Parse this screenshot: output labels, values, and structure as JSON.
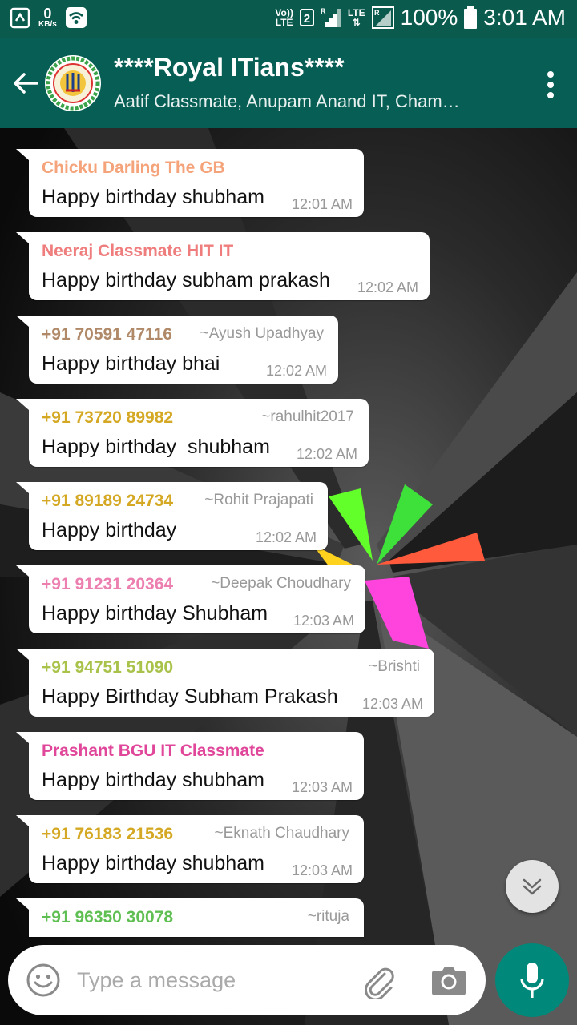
{
  "status_bar": {
    "speed_value": "0",
    "speed_unit": "KB/s",
    "volte": "Vo))\nLTE",
    "sim": "2",
    "network": "LTE",
    "battery": "100%",
    "time": "3:01 AM"
  },
  "header": {
    "title": "****Royal ITians****",
    "subtitle": "Aatif Classmate, Anupam Anand IT, Cham…"
  },
  "messages": [
    {
      "sender": "Chicku Darling The GB",
      "alias": "",
      "text": "Happy birthday shubham",
      "time": "12:01 AM",
      "color": "#f5a37a"
    },
    {
      "sender": "Neeraj Classmate HIT IT",
      "alias": "",
      "text": "Happy birthday subham prakash",
      "time": "12:02 AM",
      "color": "#ef7d7d"
    },
    {
      "sender": "+91 70591 47116",
      "alias": "~Ayush Upadhyay",
      "text": "Happy birthday bhai",
      "time": "12:02 AM",
      "color": "#b08968"
    },
    {
      "sender": "+91 73720 89982",
      "alias": "~rahulhit2017",
      "text": "Happy birthday  shubham",
      "time": "12:02 AM",
      "color": "#d4a823"
    },
    {
      "sender": "+91 89189 24734",
      "alias": "~Rohit Prajapati",
      "text": "Happy birthday",
      "time": "12:02 AM",
      "color": "#d4a823"
    },
    {
      "sender": "+91 91231 20364",
      "alias": "~Deepak Choudhary",
      "text": "Happy birthday Shubham",
      "time": "12:03 AM",
      "color": "#ec7fb0"
    },
    {
      "sender": "+91 94751 51090",
      "alias": "~Brishti",
      "text": "Happy Birthday Subham Prakash",
      "time": "12:03 AM",
      "color": "#a8c24a"
    },
    {
      "sender": "Prashant BGU IT Classmate",
      "alias": "",
      "text": "Happy birthday shubham",
      "time": "12:03 AM",
      "color": "#e0479a"
    },
    {
      "sender": "+91 76183 21536",
      "alias": "~Eknath Chaudhary",
      "text": "Happy birthday shubham",
      "time": "12:03 AM",
      "color": "#d4a823"
    },
    {
      "sender": "+91 96350 30078",
      "alias": "~rituja",
      "text": "",
      "time": "",
      "color": "#5fbf52"
    }
  ],
  "input": {
    "placeholder": "Type a message"
  },
  "icons": {
    "back": "arrow-left",
    "menu": "more-vert",
    "emoji": "smiley",
    "attach": "paperclip",
    "camera": "camera",
    "mic": "microphone",
    "scroll": "double-chevron-down"
  },
  "colors": {
    "status_bar": "#0a5a4d",
    "app_bar": "#075e54",
    "mic_button": "#00897b"
  }
}
